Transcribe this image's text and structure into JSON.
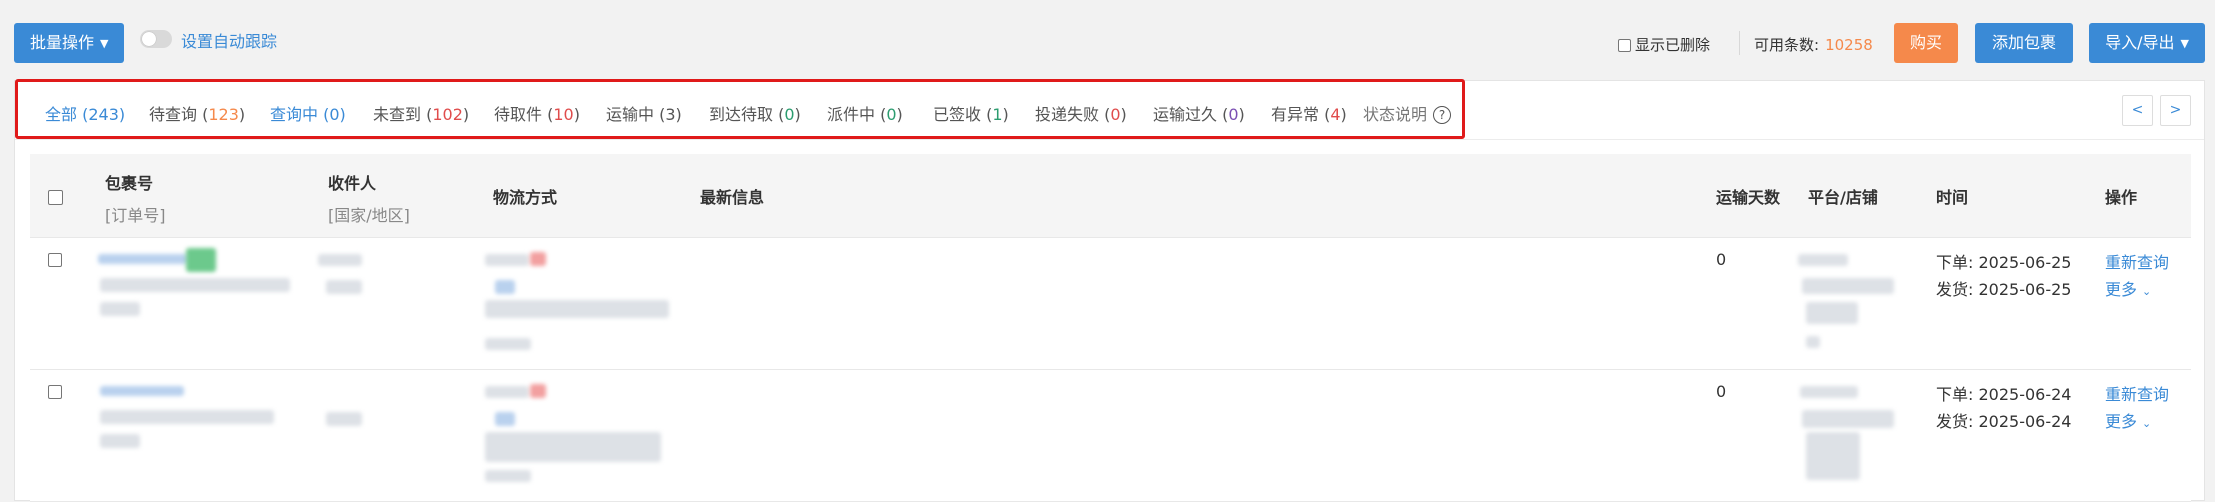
{
  "toolbar": {
    "batch_label": "批量操作",
    "auto_track_label": "设置自动跟踪",
    "show_deleted_label": "显示已删除",
    "quota_label": "可用条数:",
    "quota_value": "10258",
    "buy_label": "购买",
    "add_package_label": "添加包裹",
    "import_export_label": "导入/导出"
  },
  "status_tabs": [
    {
      "label": "全部",
      "count": "(243)"
    },
    {
      "label": "待查询",
      "count": "123"
    },
    {
      "label": "查询中",
      "count": "(0)"
    },
    {
      "label": "未查到",
      "count": "102"
    },
    {
      "label": "待取件",
      "count": "10"
    },
    {
      "label": "运输中",
      "count": "(3)"
    },
    {
      "label": "到达待取",
      "count": "0"
    },
    {
      "label": "派件中",
      "count": "0"
    },
    {
      "label": "已签收",
      "count": "1"
    },
    {
      "label": "投递失败",
      "count": "0"
    },
    {
      "label": "运输过久",
      "count": "0"
    },
    {
      "label": "有异常",
      "count": "4"
    }
  ],
  "status_help_label": "状态说明",
  "help_icon_glyph": "?",
  "pager": {
    "prev": "<",
    "next": ">"
  },
  "columns": {
    "package_no": "包裹号",
    "order_no": "[订单号]",
    "recipient": "收件人",
    "country": "[国家/地区]",
    "logistics": "物流方式",
    "latest": "最新信息",
    "days": "运输天数",
    "platform": "平台/店铺",
    "time": "时间",
    "action": "操作"
  },
  "rows": [
    {
      "days": "0",
      "order_time": "下单:  2025-06-25",
      "ship_time": "发货:  2025-06-25",
      "requery": "重新查询",
      "more": "更多"
    },
    {
      "days": "0",
      "order_time": "下单:  2025-06-24",
      "ship_time": "发货:  2025-06-24",
      "requery": "重新查询",
      "more": "更多"
    }
  ],
  "colors": {
    "primary": "#3a8ad6",
    "accent": "#f5894b",
    "highlight_border": "#e01a1a"
  }
}
